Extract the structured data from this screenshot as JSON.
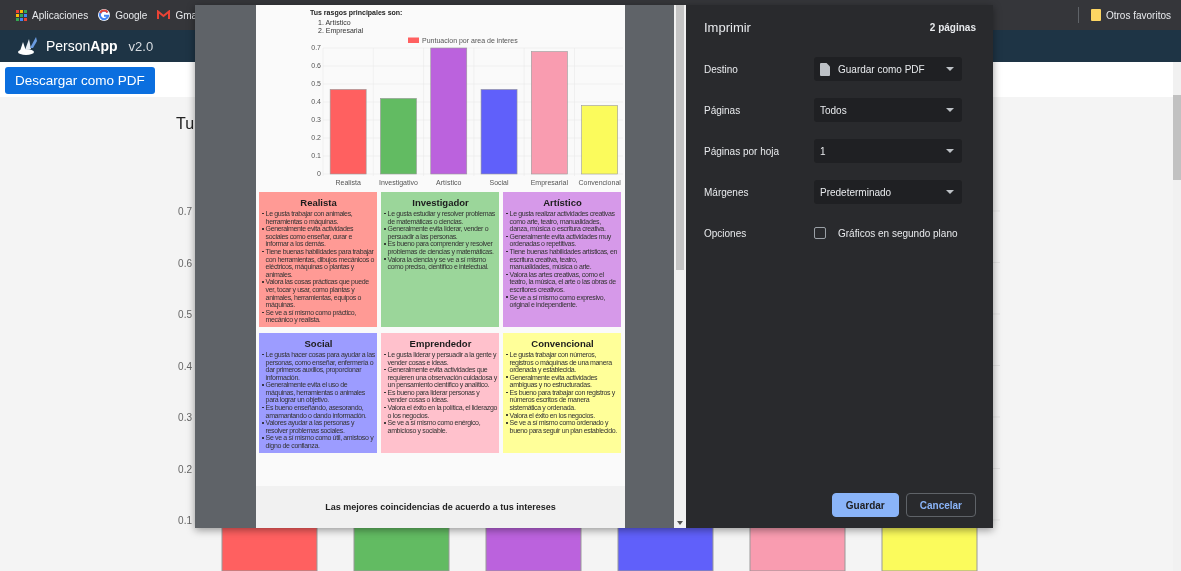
{
  "bookmarks_bar": {
    "items": [
      {
        "kind": "apps",
        "label": "Aplicaciones"
      },
      {
        "kind": "google",
        "label": "Google"
      },
      {
        "kind": "mail",
        "label": "Gma"
      }
    ],
    "other": "Otros favoritos"
  },
  "navbar": {
    "brand": "Person**App**",
    "version": "v2.0"
  },
  "download_button": "Descargar como PDF",
  "heading": "Tu",
  "background_chart": {
    "y_labels": [
      "0.7",
      "0.6",
      "0.5",
      "0.4",
      "0.3",
      "0.2",
      "0.1"
    ],
    "bars": [
      {
        "color": "#ff6060"
      },
      {
        "color": "#62bb62"
      },
      {
        "color": "#bb62dd"
      },
      {
        "color": "#6060fa"
      },
      {
        "color": "#f99cb0"
      },
      {
        "color": "#fbfb5c"
      }
    ]
  },
  "print_dialog": {
    "preview": {
      "title": "Tus rasgos principales son:",
      "traits": [
        "1. Artístico",
        "2. Empresarial"
      ],
      "chart_data": {
        "type": "bar",
        "categories": [
          "Realista",
          "Investigativo",
          "Artístico",
          "Social",
          "Empresarial",
          "Convencional"
        ],
        "series": [
          {
            "name": "Puntuacion por area de interes",
            "color": "#ff6060",
            "colors": [
              "#ff6060",
              "#62bb62",
              "#bb62dd",
              "#6060fa",
              "#f99cb0",
              "#fbfb5c"
            ],
            "values": [
              0.47,
              0.42,
              0.7,
              0.47,
              0.68,
              0.38
            ]
          }
        ],
        "grid": true,
        "ylim": [
          0,
          0.7
        ],
        "yticks": [
          {
            "value": 0,
            "label": "0"
          },
          {
            "value": 0.1,
            "label": "0.1"
          },
          {
            "value": 0.2,
            "label": "0.2"
          },
          {
            "value": 0.3,
            "label": "0.3"
          },
          {
            "value": 0.4,
            "label": "0.4"
          },
          {
            "value": 0.5,
            "label": "0.5"
          },
          {
            "value": 0.6,
            "label": "0.6"
          },
          {
            "value": 0.7,
            "label": "0.7"
          }
        ]
      },
      "cards": [
        {
          "title": "Realista",
          "color": "#ff9a95",
          "items": [
            "Le gusta trabajar con animales, herramientas o máquinas.",
            "Generalmente evita actividades sociales como enseñar, curar e informar a los demás.",
            "Tiene buenas habilidades para trabajar con herramientas, dibujos mecánicos o eléctricos, máquinas o plantas y animales.",
            "Valora las cosas prácticas que puede ver, tocar y usar, como plantas y animales, herramientas, equipos o máquinas.",
            "Se ve a sí mismo como práctico, mecánico y realista."
          ]
        },
        {
          "title": "Investigador",
          "color": "#9bd69a",
          "items": [
            "Le gusta estudiar y resolver problemas de matemáticas o ciencias.",
            "Generalmente evita liderar, vender o persuadir a las personas.",
            "Es bueno para comprender y resolver problemas de ciencias y matemáticas.",
            "Valora la ciencia y se ve a sí mismo como preciso, científico e intelectual."
          ]
        },
        {
          "title": "Artístico",
          "color": "#d699e9",
          "items": [
            "Le gusta realizar actividades creativas como arte, teatro, manualidades, danza, música o escritura creativa.",
            "Generalmente evita actividades muy ordenadas o repetitivas.",
            "Tiene buenas habilidades artísticas, en escritura creativa, teatro, manualidades, música o arte.",
            "Valora las artes creativas, como el teatro, la música, el arte o las obras de escritores creativos.",
            "Se ve a sí mismo como expresivo, original e independiente."
          ]
        },
        {
          "title": "Social",
          "color": "#9c9cff",
          "items": [
            "Le gusta hacer cosas para ayudar a las personas, como enseñar, enfermería o dar primeros auxilios, proporcionar información.",
            "Generalmente evita el uso de máquinas, herramientas o animales para lograr un objetivo.",
            "Es bueno enseñando, asesorando, amamantando o dando información.",
            "Valores ayudar a las personas y resolver problemas sociales.",
            "Se ve a sí mismo como útil, amistoso y digno de confianza."
          ]
        },
        {
          "title": "Emprendedor",
          "color": "#ffc1cc",
          "items": [
            "Le gusta liderar y persuadir a la gente y vender cosas e ideas.",
            "Generalmente evita actividades que requieren una observación cuidadosa y un pensamiento científico y analítico.",
            "Es bueno para liderar personas y vender cosas o ideas.",
            "Valora el éxito en la política, el liderazgo o los negocios.",
            "Se ve a sí mismo como enérgico, ambicioso y sociable."
          ]
        },
        {
          "title": "Convencional",
          "color": "#ffff99",
          "items": [
            "Le gusta trabajar con números, registros o máquinas de una manera ordenada y establecida.",
            "Generalmente evita actividades ambiguas y no estructuradas.",
            "Es bueno para trabajar con registros y números escritos de manera sistemática y ordenada.",
            "Valora el éxito en los negocios.",
            "Se ve a sí mismo como ordenado y bueno para seguir un plan establecido."
          ]
        }
      ],
      "footer_heading": "Las mejores coincidencias de acuerdo a tus intereses"
    },
    "title": "Imprimir",
    "page_count": "2 páginas",
    "settings": [
      {
        "kind": "destination",
        "label": "Destino",
        "value": "Guardar como PDF"
      },
      {
        "kind": "select",
        "label": "Páginas",
        "value": "Todos"
      },
      {
        "kind": "select",
        "label": "Páginas por hoja",
        "value": "1"
      },
      {
        "kind": "select",
        "label": "Márgenes",
        "value": "Predeterminado"
      },
      {
        "kind": "checkbox",
        "label": "Opciones",
        "value": "Gráficos en segundo plano",
        "checked": false
      }
    ],
    "buttons": [
      {
        "label": "Guardar",
        "primary": true
      },
      {
        "label": "Cancelar",
        "primary": false
      }
    ]
  }
}
